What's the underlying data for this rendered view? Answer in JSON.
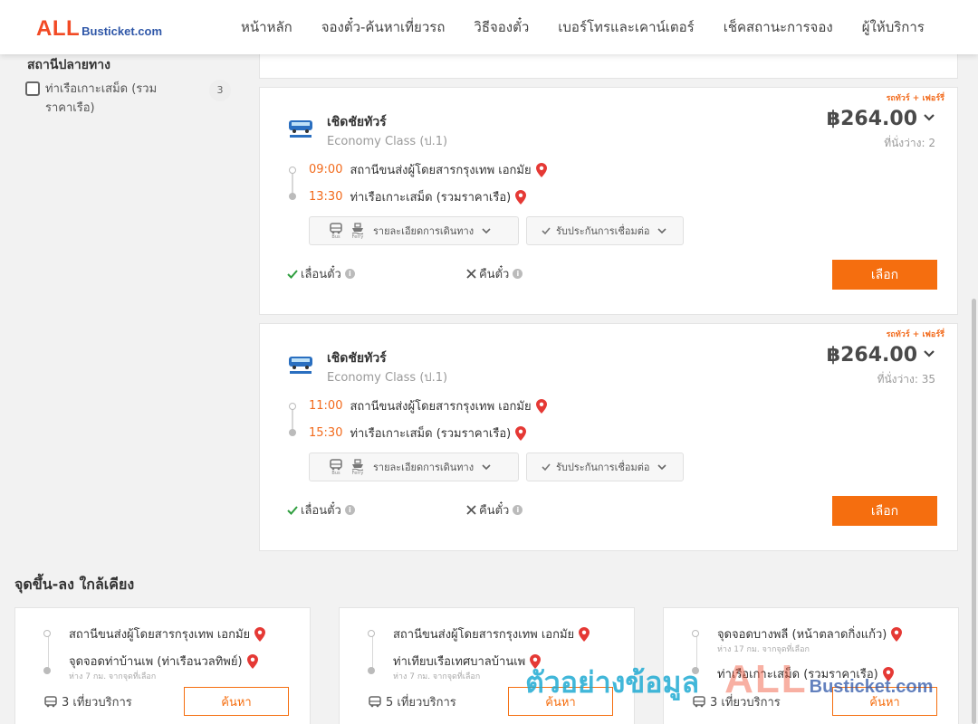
{
  "header": {
    "logo_all": "ALL",
    "logo_rest": "Busticket.com",
    "nav": [
      "หน้าหลัก",
      "จองตั๋ว-ค้นหาเที่ยวรถ",
      "วิธีจองตั๋ว",
      "เบอร์โทรและเคาน์เตอร์",
      "เช็คสถานะการจอง",
      "ผู้ให้บริการ"
    ]
  },
  "filter": {
    "title": "สถานีปลายทาง",
    "option_label": "ท่าเรือเกาะเสม็ด (รวมราคาเรือ)",
    "option_count": "3"
  },
  "results": [
    {
      "promo": "รถทัวร์ + เฟอร์รี่",
      "operator": "เชิดชัยทัวร์",
      "class": "Economy Class (ป.1)",
      "price": "฿264.00",
      "seats": "ที่นั่งว่าง: 2",
      "depart_time": "09:00",
      "depart_station": "สถานีขนส่งผู้โดยสารกรุงเทพ เอกมัย",
      "arrive_time": "13:30",
      "arrive_station": "ท่าเรือเกาะเสม็ด (รวมราคาเรือ)",
      "bus_label": "Bus",
      "ferry_label": "Ferry",
      "details_label": "รายละเอียดการเดินทาง",
      "insurance_label": "รับประกันการเชื่อมต่อ",
      "reschedule_label": "เลื่อนตั๋ว",
      "refund_label": "คืนตั๋ว",
      "select_label": "เลือก"
    },
    {
      "promo": "รถทัวร์ + เฟอร์รี่",
      "operator": "เชิดชัยทัวร์",
      "class": "Economy Class (ป.1)",
      "price": "฿264.00",
      "seats": "ที่นั่งว่าง: 35",
      "depart_time": "11:00",
      "depart_station": "สถานีขนส่งผู้โดยสารกรุงเทพ เอกมัย",
      "arrive_time": "15:30",
      "arrive_station": "ท่าเรือเกาะเสม็ด (รวมราคาเรือ)",
      "bus_label": "Bus",
      "ferry_label": "Ferry",
      "details_label": "รายละเอียดการเดินทาง",
      "insurance_label": "รับประกันการเชื่อมต่อ",
      "reschedule_label": "เลื่อนตั๋ว",
      "refund_label": "คืนตั๋ว",
      "select_label": "เลือก"
    }
  ],
  "nearby": {
    "title": "จุดขึ้น-ลง ใกล้เคียง",
    "cards": [
      {
        "from": "สถานีขนส่งผู้โดยสารกรุงเทพ เอกมัย",
        "from_note": "",
        "to": "จุดจอดท่าบ้านเพ (ท่าเรือนวลทิพย์)",
        "to_note": "ห่าง 7 กม. จากจุดที่เลือก",
        "services": "3 เที่ยวบริการ",
        "search_label": "ค้นหา"
      },
      {
        "from": "สถานีขนส่งผู้โดยสารกรุงเทพ เอกมัย",
        "from_note": "",
        "to": "ท่าเทียบเรือเทศบาลบ้านเพ",
        "to_note": "ห่าง 7 กม. จากจุดที่เลือก",
        "services": "5 เที่ยวบริการ",
        "search_label": "ค้นหา"
      },
      {
        "from": "จุดจอดบางพลี (หน้าตลาดกิ่งแก้ว)",
        "from_note": "ห่าง 17 กม. จากจุดที่เลือก",
        "to": "ท่าเรือเกาะเสม็ด (รวมราคาเรือ)",
        "to_note": "",
        "services": "3 เที่ยวบริการ",
        "search_label": "ค้นหา"
      }
    ]
  },
  "watermark": {
    "thai": "ตัวอย่างข้อมูล",
    "all": "ALL",
    "rest": "Busticket.com"
  },
  "colors": {
    "accent": "#f56e0f",
    "brand_red": "#f24a25",
    "brand_blue": "#2f57a8",
    "pin": "#e53935",
    "check": "#2e9e3e"
  }
}
